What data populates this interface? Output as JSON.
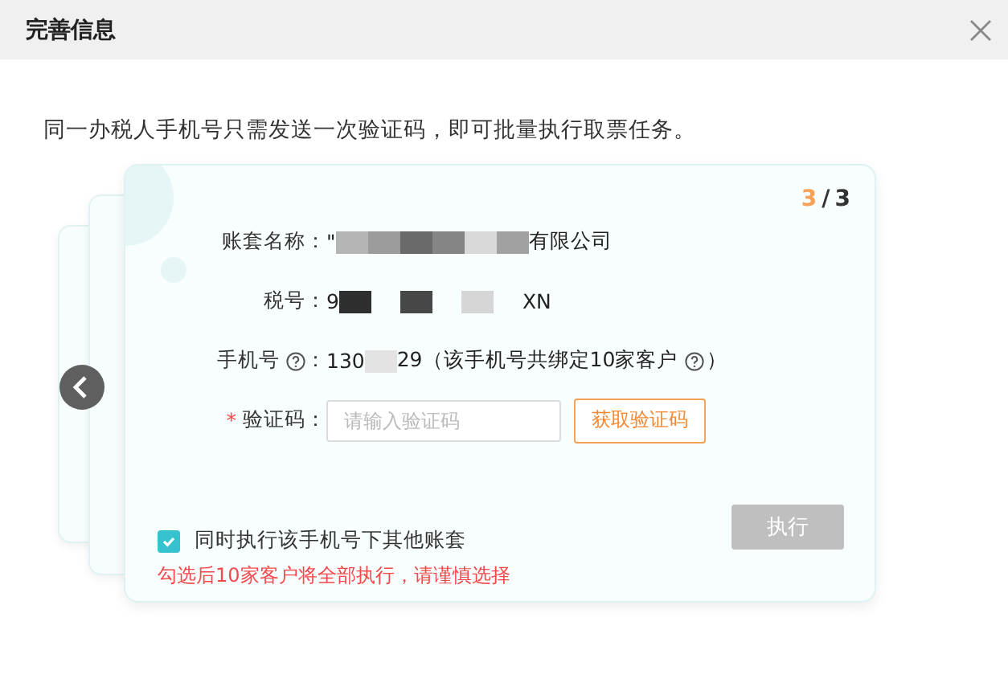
{
  "dialog": {
    "title": "完善信息"
  },
  "intro": "同一办税人手机号只需发送一次验证码，即可批量执行取票任务。",
  "pager": {
    "current": "3",
    "separator": "/",
    "total": "3"
  },
  "fields": [
    {
      "kind": "text",
      "label": "账套名称：",
      "segments": [
        {
          "kind": "text",
          "text": "\""
        },
        {
          "kind": "redacted",
          "color": "#b5b5b5"
        },
        {
          "kind": "redacted",
          "color": "#9c9c9c"
        },
        {
          "kind": "redacted",
          "color": "#6a6a6a"
        },
        {
          "kind": "redacted",
          "color": "#858585"
        },
        {
          "kind": "redacted",
          "color": "#d9d9d9"
        },
        {
          "kind": "redacted",
          "color": "#a1a1a1"
        },
        {
          "kind": "text",
          "text": "有限公司"
        }
      ]
    },
    {
      "kind": "text",
      "label": "税号：",
      "segments": [
        {
          "kind": "text",
          "text": "9"
        },
        {
          "kind": "redacted",
          "color": "#2e2e2e"
        },
        {
          "kind": "gap"
        },
        {
          "kind": "redacted",
          "color": "#474747"
        },
        {
          "kind": "gap"
        },
        {
          "kind": "redacted",
          "color": "#d6d6d6"
        },
        {
          "kind": "gap"
        },
        {
          "kind": "text",
          "text": "XN"
        }
      ]
    },
    {
      "kind": "phone",
      "label": "手机号",
      "segments": [
        {
          "kind": "text",
          "text": "130"
        },
        {
          "kind": "redacted",
          "color": "#e3e3e3"
        },
        {
          "kind": "text",
          "text": "29（该手机号共绑定10家客户"
        }
      ],
      "colon": "：",
      "suffix": "）"
    },
    {
      "kind": "code",
      "label": "验证码：",
      "required": true,
      "required_mark": "*",
      "placeholder": "请输入验证码",
      "button": "获取验证码"
    }
  ],
  "sync": {
    "checked": true,
    "label": "同时执行该手机号下其他账套",
    "warning": "勾选后10家客户将全部执行，请谨慎选择"
  },
  "execute": {
    "label": "执行",
    "disabled": true
  }
}
